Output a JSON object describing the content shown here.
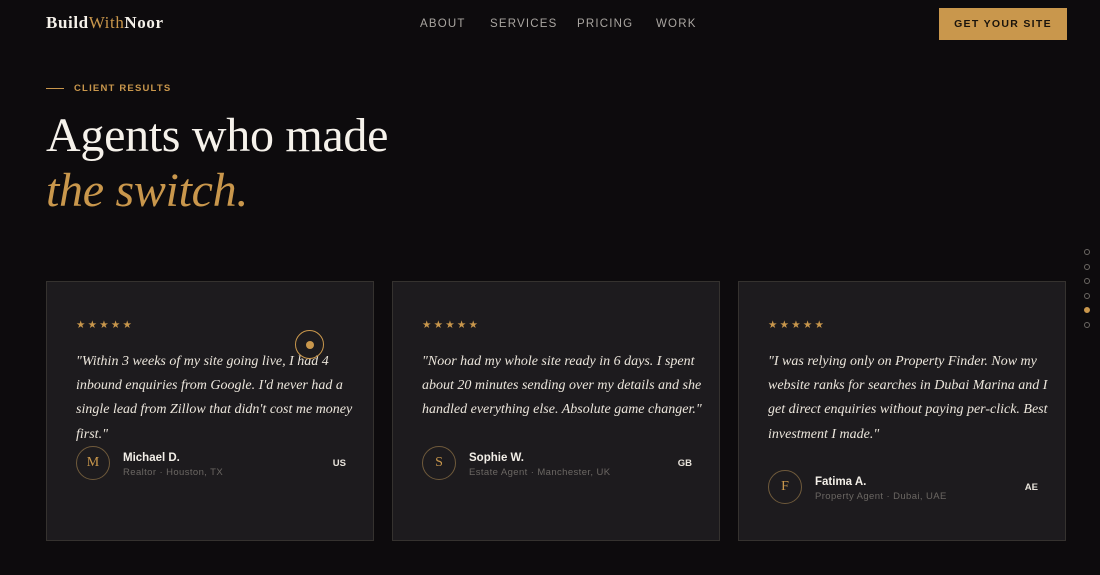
{
  "brand": {
    "logo_part1": "Build",
    "logo_part2": "With",
    "logo_part3": "Noor"
  },
  "nav": {
    "items": [
      "ABOUT",
      "SERVICES",
      "PRICING",
      "WORK"
    ]
  },
  "cta": {
    "label": "GET YOUR SITE"
  },
  "section": {
    "eyebrow": "CLIENT RESULTS",
    "heading_line1": "Agents who made",
    "heading_line2": "the switch."
  },
  "side_nav": {
    "dot_count": 6,
    "active_index": 4
  },
  "testimonials": [
    {
      "stars": "★★★★★",
      "quote": "\"Within 3 weeks of my site going live, I had 4 inbound enquiries from Google. I'd never had a single lead from Zillow that didn't cost me money first.\"",
      "initial": "M",
      "name": "Michael D.",
      "role": "Realtor · Houston, TX",
      "country": "US"
    },
    {
      "stars": "★★★★★",
      "quote": "\"Noor had my whole site ready in 6 days. I spent about 20 minutes sending over my details and she handled everything else. Absolute game changer.\"",
      "initial": "S",
      "name": "Sophie W.",
      "role": "Estate Agent · Manchester, UK",
      "country": "GB"
    },
    {
      "stars": "★★★★★",
      "quote": "\"I was relying only on Property Finder. Now my website ranks for searches in Dubai Marina and I get direct enquiries without paying per-click. Best investment I made.\"",
      "initial": "F",
      "name": "Fatima A.",
      "role": "Property Agent · Dubai, UAE",
      "country": "AE"
    }
  ],
  "colors": {
    "accent": "#c9974c",
    "background": "#0d0b0d",
    "card": "#1d1b1e"
  }
}
